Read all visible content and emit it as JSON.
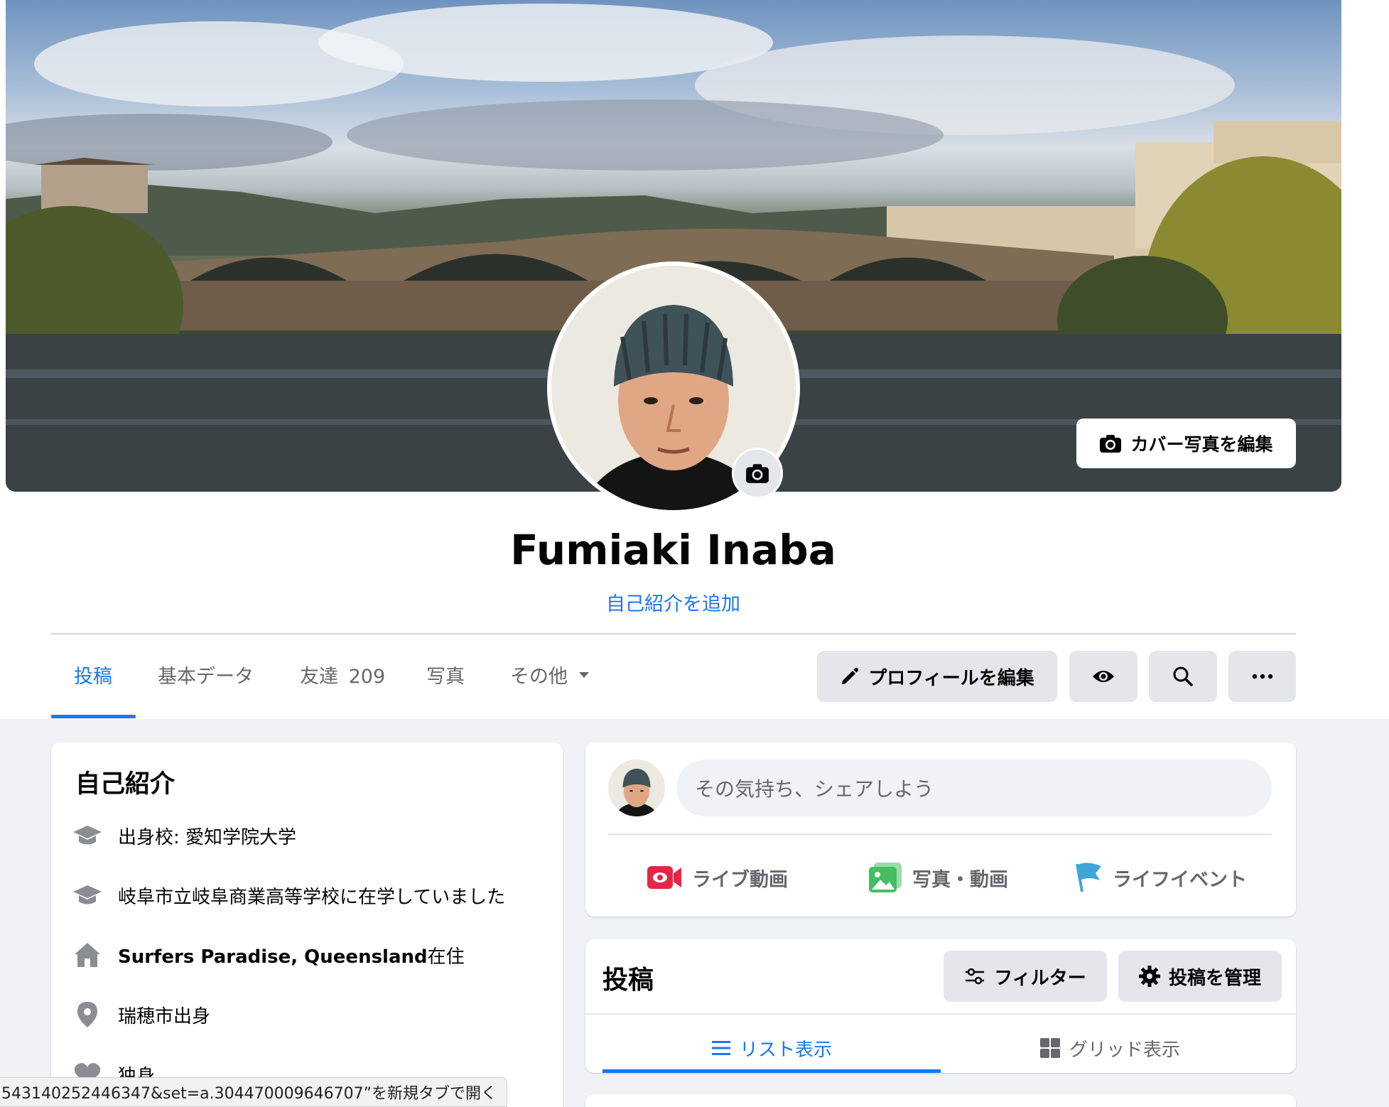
{
  "cover": {
    "edit_label": "カバー写真を編集"
  },
  "profile": {
    "name": "Fumiaki Inaba",
    "bio_link": "自己紹介を追加"
  },
  "tabs": {
    "posts": "投稿",
    "about": "基本データ",
    "friends": "友達",
    "friends_count": "209",
    "photos": "写真",
    "more": "その他"
  },
  "actions": {
    "edit_profile": "プロフィールを編集"
  },
  "intro": {
    "title": "自己紹介",
    "items": [
      {
        "text": "出身校: 愛知学院大学",
        "icon": "graduation-cap-icon"
      },
      {
        "text": "岐阜市立岐阜商業高等学校に在学していました",
        "icon": "graduation-cap-icon"
      },
      {
        "bold": "Surfers Paradise, Queensland",
        "text": "在住",
        "icon": "home-icon"
      },
      {
        "text": "瑞穂市出身",
        "icon": "location-pin-icon"
      },
      {
        "text": "独身",
        "icon": "heart-icon"
      }
    ]
  },
  "composer": {
    "placeholder": "その気持ち、シェアしよう",
    "live_video": "ライブ動画",
    "photo_video": "写真・動画",
    "life_event": "ライフイベント"
  },
  "posts_section": {
    "title": "投稿",
    "filter": "フィルター",
    "manage": "投稿を管理",
    "list_view": "リスト表示",
    "grid_view": "グリッド表示"
  },
  "status_bar": {
    "text": "543140252446347&set=a.304470009646707”を新規タブで開く"
  },
  "colors": {
    "accent": "#1877f2",
    "live": "#e42645",
    "photo": "#45bd62",
    "event": "#3ea6d9"
  }
}
